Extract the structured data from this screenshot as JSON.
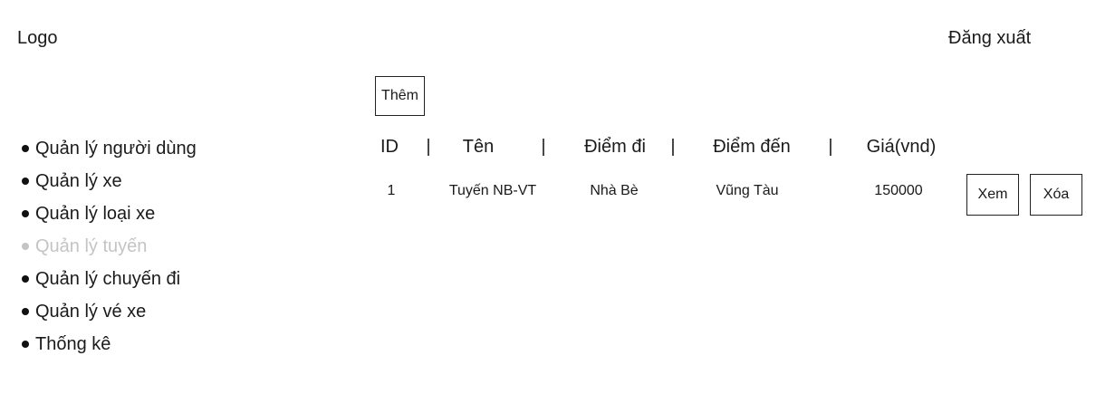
{
  "header": {
    "logo": "Logo",
    "logout_label": "Đăng xuất"
  },
  "toolbar": {
    "add_label": "Thêm"
  },
  "sidebar": {
    "items": [
      {
        "label": "Quản lý người dùng"
      },
      {
        "label": "Quản lý xe"
      },
      {
        "label": "Quản lý loại xe"
      },
      {
        "label": "Quản lý tuyến",
        "state": "disabled"
      },
      {
        "label": "Quản lý chuyến đi"
      },
      {
        "label": "Quản lý vé xe"
      },
      {
        "label": "Thống kê"
      }
    ]
  },
  "table": {
    "columns": [
      "ID",
      "Tên",
      "Điểm đi",
      "Điểm đến",
      "Giá(vnd)"
    ],
    "separator": "|",
    "rows": [
      {
        "cells": [
          "1",
          "Tuyến NB-VT",
          "Nhà Bè",
          "Vũng Tàu",
          "150000"
        ],
        "view_label": "Xem",
        "delete_label": "Xóa"
      }
    ]
  },
  "colors": {
    "text": "#1a1a1a",
    "disabled": "#c4c4c4",
    "border": "#222222"
  }
}
